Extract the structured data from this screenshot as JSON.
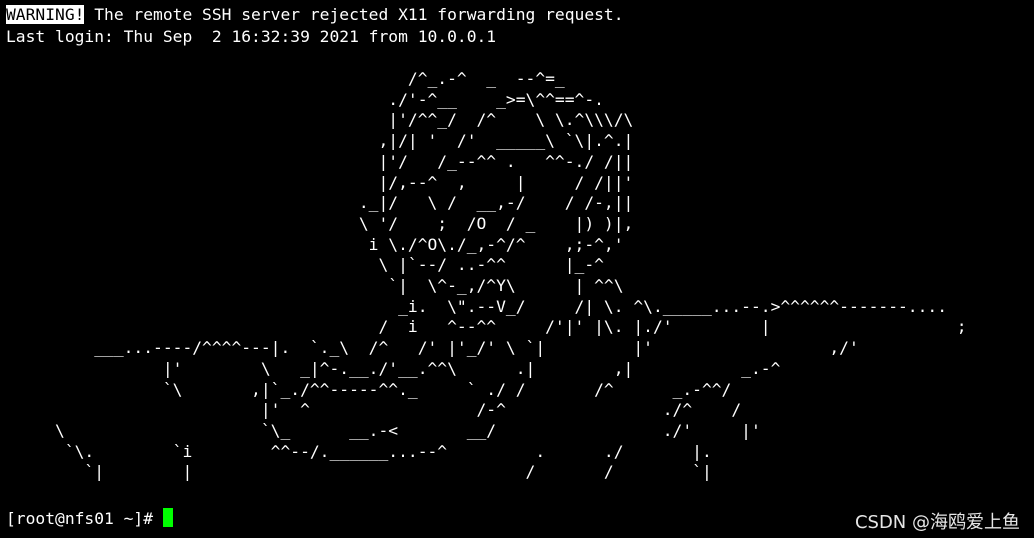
{
  "terminal": {
    "warning_badge": "WARNING!",
    "warning_text": " The remote SSH server rejected X11 forwarding request.",
    "last_login": "Last login: Thu Sep  2 16:32:39 2021 from 10.0.0.1",
    "ascii_art": "                                         /^_.-^  _  --^=_\n                                       ./'-^__    _>=\\^^==^-.\n                                       |'/^^_/  /^    \\ \\.^\\\\\\/\\\n                                      ,|/| '  /'  _____\\ `\\|.^.|\n                                      |'/   /_--^^ .   ^^-./ /||\n                                      |/,--^  ,     |     / /||'\n                                    ._|/   \\ /  __,-/    / /-,||\n                                    \\ '/    ;  /O  / _    |) )|,\n                                     i \\./^O\\./_,-^/^    ,;-^,'\n                                      \\ |`--/ ..-^^      |_-^\n                                       `|  \\^-_,/^Y\\      | ^^\\\n                                        _i.  \\\".--V_/     /| \\. ^\\._____...--.>^^^^^^-------....\n                                      /  i   ^--^^     /'|' |\\. |./'         |                   ;\n         ___...----/^^^^---|.  `._\\  /^   /' |'_/' \\ `|         |'                  ,/'\n                |'        \\   _|^-.__./'__.^^\\      .|        ,|           _.-^\n                `\\       ,|`_./^^-----^^._     ` ./ /       /^      _.-^^/\n                          |'  ^                 /-^                ./^    /\n     \\                    `\\_      __.-<       __/                 ./'     |'\n      `\\.        `i        ^^--/.______...--^         .      ./       |.\n        `|        |                                  /       /        `|",
    "prompt": "[root@nfs01 ~]# "
  },
  "watermark": "CSDN @海鸥爱上鱼",
  "colors": {
    "background": "#000000",
    "text": "#ffffff",
    "cursor": "#00ff00"
  }
}
